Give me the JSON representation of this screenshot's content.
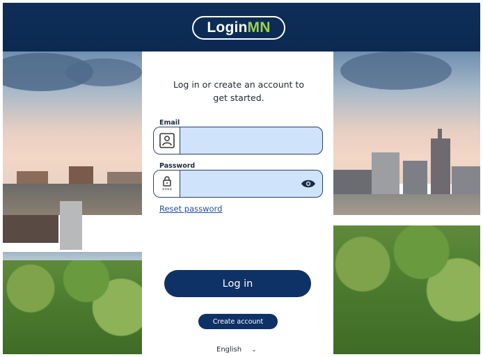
{
  "header": {
    "logo_part1": "Login",
    "logo_part2": "MN",
    "background_color": "#0b2a52",
    "accent_color": "#9bd24a"
  },
  "card": {
    "intro_text": "Log in or create an account to get started.",
    "email": {
      "label": "Email",
      "value": "",
      "icon": "id-badge-icon"
    },
    "password": {
      "label": "Password",
      "value": "",
      "icon": "lock-icon",
      "toggle_icon": "eye-icon"
    },
    "reset_link": "Reset password",
    "login_button": "Log in",
    "create_button": "Create account",
    "language": {
      "selected": "English",
      "icon": "chevron-down-icon"
    },
    "button_color": "#0e3166",
    "input_bg_color": "#cfe3fb"
  }
}
